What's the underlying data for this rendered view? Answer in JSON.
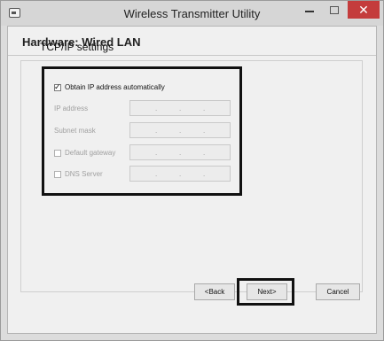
{
  "window": {
    "title": "Wireless Transmitter Utility",
    "app_icon": "app-icon",
    "minimize_icon": "minimize-icon",
    "maximize_icon": "maximize-icon",
    "close_label": "✕"
  },
  "header": {
    "title": "Hardware: Wired LAN"
  },
  "section": {
    "title": "TCP/IP settings"
  },
  "form": {
    "obtain_auto": {
      "label": "Obtain IP address automatically",
      "checked": true
    },
    "ip_address": {
      "label": "IP address",
      "value": ". . ."
    },
    "subnet_mask": {
      "label": "Subnet mask",
      "value": ". . ."
    },
    "default_gateway": {
      "label": "Default gateway",
      "checked": false,
      "value": ". . ."
    },
    "dns_server": {
      "label": "DNS Server",
      "checked": false,
      "value": ". . ."
    }
  },
  "buttons": {
    "back": "<Back",
    "next": "Next>",
    "cancel": "Cancel"
  }
}
